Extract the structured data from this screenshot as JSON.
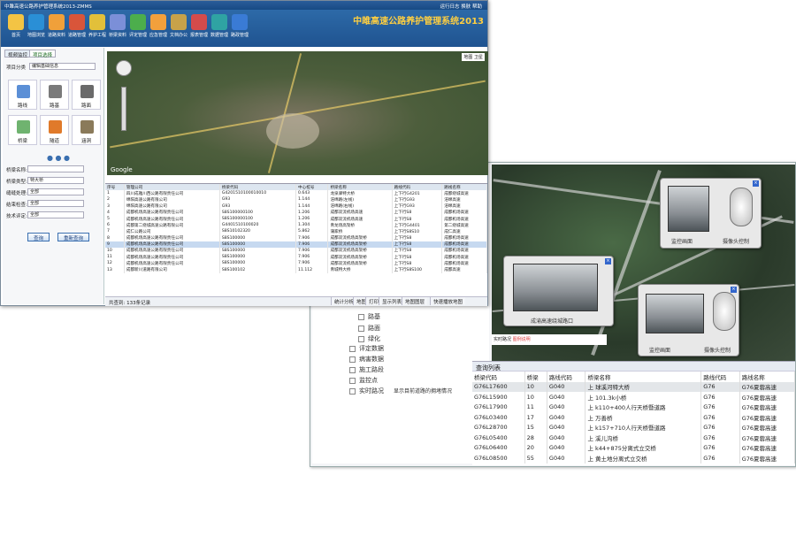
{
  "front": {
    "title": "中雎高速公路养护管理系统2013-ZMMS",
    "title_right": [
      "运行日志",
      "换肤",
      "帮助"
    ],
    "brand": "中雎高速公路养护管理系统2013",
    "toolbar": [
      {
        "label": "首页",
        "color": "#f3c444"
      },
      {
        "label": "地图浏览",
        "color": "#2a8fd6"
      },
      {
        "label": "道路资料",
        "color": "#f0a03a"
      },
      {
        "label": "道路管理",
        "color": "#d9553a"
      },
      {
        "label": "养护工程",
        "color": "#e2c03a"
      },
      {
        "label": "桥梁资料",
        "color": "#7b8fd8"
      },
      {
        "label": "评定管理",
        "color": "#4cae4c"
      },
      {
        "label": "应急管理",
        "color": "#f2a03c"
      },
      {
        "label": "文档办公",
        "color": "#c7a24a"
      },
      {
        "label": "报表管理",
        "color": "#d44b4b"
      },
      {
        "label": "数据管理",
        "color": "#2fa3a3"
      },
      {
        "label": "路政管理",
        "color": "#3a7bd5"
      }
    ],
    "sidebar": {
      "tabs": [
        "视频监控",
        "项目选择"
      ],
      "project_label": "项目分类",
      "project_value": "编辑基础信息",
      "grid": [
        {
          "label": "路线",
          "color": "#5b8fd6"
        },
        {
          "label": "路基",
          "color": "#7a7a7a"
        },
        {
          "label": "路面",
          "color": "#6a6a6a"
        },
        {
          "label": "桥梁",
          "color": "#6fb36f"
        },
        {
          "label": "隧道",
          "color": "#e07a2a"
        },
        {
          "label": "涵洞",
          "color": "#8a7a5a"
        }
      ],
      "filters": [
        {
          "label": "桥梁名称:",
          "value": ""
        },
        {
          "label": "桥梁类型:",
          "value": "特大桥"
        },
        {
          "label": "缝缝处理:",
          "value": "全部"
        },
        {
          "label": "结束检查:",
          "value": "全部"
        },
        {
          "label": "技术评定:",
          "value": "全部"
        }
      ],
      "query_btn": "查询",
      "reset_btn": "重新查询"
    },
    "map": {
      "type_btns": [
        "地图",
        "卫星"
      ],
      "logo": "Google"
    },
    "table": {
      "headers": [
        "序号",
        "管理公司",
        "桥梁代码",
        "中心桩号",
        "桥梁名称",
        "路线代码",
        "路线名称"
      ],
      "rows": [
        [
          "1",
          "四川成雅川西公路有限责任公司",
          "G4201510100010010",
          "0.643",
          "龙泉驿特大桥",
          "上下行G4201",
          "成都绕城高速"
        ],
        [
          "2",
          "绵阳高速公路有限公司",
          "G93",
          "1.144",
          "涪绵路(左线)",
          "上下行G93",
          "涪绵高速"
        ],
        [
          "3",
          "绵阳高速公路有限公司",
          "G93",
          "1.144",
          "涪绵路(右线)",
          "上下行G93",
          "涪绵高速"
        ],
        [
          "4",
          "成都机场高速公路有限责任公司",
          "S8S100000100",
          "1.206",
          "成都双流机场高速",
          "上下行S8",
          "成都机场高速"
        ],
        [
          "5",
          "成都机场高速公路有限责任公司",
          "S8S100000100",
          "1.206",
          "成都双流机场高速",
          "上下行S8",
          "成都机场高速"
        ],
        [
          "6",
          "成都第二绕城高速公路有限公司",
          "G4401510100020",
          "1.304",
          "青龙场高架桥",
          "上下行G4401",
          "第二绕城高速"
        ],
        [
          "7",
          "成仁公路公司",
          "S8S10102320",
          "5.862",
          "蒲家桥",
          "上下行S8S10",
          "成仁高速"
        ],
        [
          "8",
          "成都机场高速公路有限责任公司",
          "S8S100000",
          "7.906",
          "成都双流机场高架桥",
          "上下行S8",
          "成都机场高速"
        ],
        [
          "9",
          "成都机场高速公路有限责任公司",
          "S8S100000",
          "7.906",
          "成都双流机场高架桥",
          "上下行S8",
          "成都机场高速"
        ],
        [
          "10",
          "成都机场高速公路有限责任公司",
          "S8S100000",
          "7.906",
          "成都双流机场高架桥",
          "上下行S8",
          "成都机场高速"
        ],
        [
          "11",
          "成都机场高速公路有限责任公司",
          "S8S100000",
          "7.906",
          "成都双流机场高架桥",
          "上下行S8",
          "成都机场高速"
        ],
        [
          "12",
          "成都机场高速公路有限责任公司",
          "S8S100000",
          "7.906",
          "成都双流机场高架桥",
          "上下行S8",
          "成都机场高速"
        ],
        [
          "13",
          "成都新川道路有限公司",
          "S8S100102",
          "11.112",
          "青城特大桥",
          "上下行S8S100",
          "成都高速"
        ]
      ],
      "selected_row": 8
    },
    "status": {
      "count": "共查到: 133条记录",
      "buttons": [
        "统计分析",
        "地图",
        "打印",
        "显示列表",
        "地图图层",
        "快速播放地图"
      ]
    }
  },
  "back": {
    "checks": [
      "路基",
      "路面",
      "绿化",
      "评定数据",
      "病害数据",
      "施工路段",
      "监控点",
      "实时路况"
    ],
    "realtime_note": "显示目前道路的拥堵情况",
    "map_legend": [
      "实时路况",
      "图例说明"
    ],
    "cam_popups": [
      {
        "caption": "监控画面",
        "ctrl": "摄像头控制"
      },
      {
        "caption": "成渝高速绕城路口",
        "ctrl": ""
      },
      {
        "caption": "监控画面",
        "ctrl": "摄像头控制"
      }
    ],
    "list": {
      "title": "查询列表",
      "headers": [
        "桥梁代码",
        "桥梁",
        "路线代码",
        "桥梁名称",
        "路线代码",
        "路线名称"
      ],
      "rows": [
        [
          "G76L17600",
          "10",
          "G040",
          "上 球溪河特大桥",
          "G76",
          "G76夏蓉高速"
        ],
        [
          "G76L15900",
          "10",
          "G040",
          "上 101.3k小桥",
          "G76",
          "G76夏蓉高速"
        ],
        [
          "G76L17900",
          "11",
          "G040",
          "上 k110+400人行天桥暨道路",
          "G76",
          "G76夏蓉高速"
        ],
        [
          "G76L03400",
          "17",
          "G040",
          "上 万善桥",
          "G76",
          "G76夏蓉高速"
        ],
        [
          "G76L28700",
          "15",
          "G040",
          "上 k157+710人行天桥暨道路",
          "G76",
          "G76夏蓉高速"
        ],
        [
          "G76L05400",
          "28",
          "G040",
          "上 溪儿沟桥",
          "G76",
          "G76夏蓉高速"
        ],
        [
          "G76L06400",
          "20",
          "G040",
          "上 k44+875分离式立交桥",
          "G76",
          "G76夏蓉高速"
        ],
        [
          "G76L08500",
          "55",
          "G040",
          "上 黄土地分离式立交桥",
          "G76",
          "G76夏蓉高速"
        ]
      ],
      "selected_row": 0
    }
  }
}
